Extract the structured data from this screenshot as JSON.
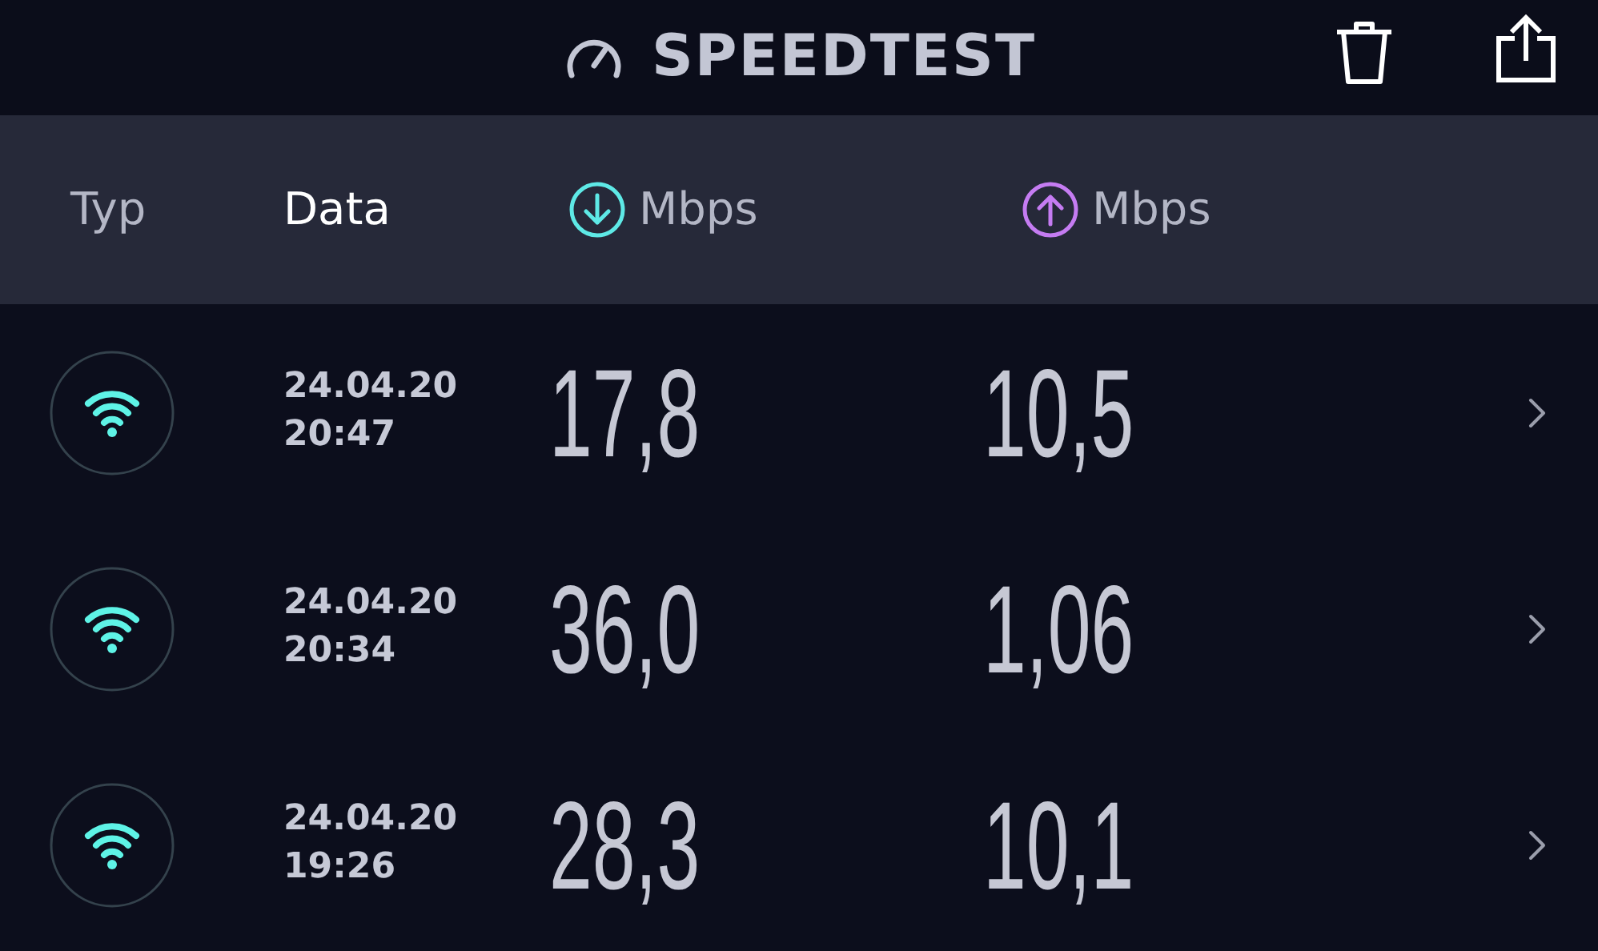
{
  "header": {
    "title": "SPEEDTEST"
  },
  "columns": [
    {
      "kind": "text",
      "label": "Typ",
      "selected": false
    },
    {
      "kind": "text",
      "label": "Data",
      "selected": true
    },
    {
      "kind": "download",
      "label": "Mbps",
      "selected": false
    },
    {
      "kind": "upload",
      "label": "Mbps",
      "selected": false
    }
  ],
  "results": [
    {
      "kind": "wifi",
      "date": "24.04.20",
      "time": "20:47",
      "download": "17,8",
      "upload": "10,5"
    },
    {
      "kind": "wifi",
      "date": "24.04.20",
      "time": "20:34",
      "download": "36,0",
      "upload": "1,06"
    },
    {
      "kind": "wifi",
      "date": "24.04.20",
      "time": "19:26",
      "download": "28,3",
      "upload": "10,1"
    }
  ]
}
